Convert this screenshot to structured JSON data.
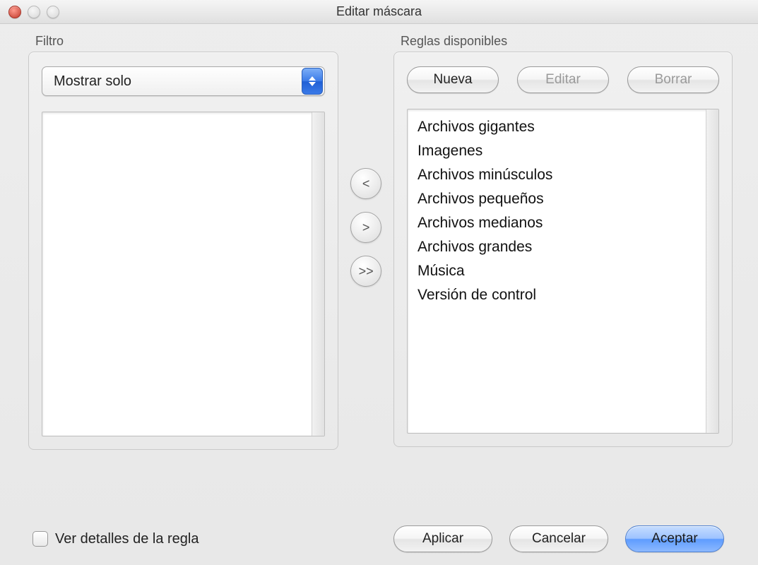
{
  "window": {
    "title": "Editar máscara"
  },
  "filter": {
    "group_label": "Filtro",
    "mode_selected": "Mostrar solo"
  },
  "transfer": {
    "move_left": "<",
    "move_right": ">",
    "move_all_right": ">>"
  },
  "rules": {
    "group_label": "Reglas disponibles",
    "new_label": "Nueva",
    "edit_label": "Editar",
    "delete_label": "Borrar",
    "items": [
      "Archivos gigantes",
      "Imagenes",
      "Archivos minúsculos",
      "Archivos pequeños",
      "Archivos medianos",
      "Archivos grandes",
      "Música",
      "Versión de control"
    ]
  },
  "footer": {
    "details_label": "Ver detalles de la regla",
    "apply_label": "Aplicar",
    "cancel_label": "Cancelar",
    "accept_label": "Aceptar"
  }
}
